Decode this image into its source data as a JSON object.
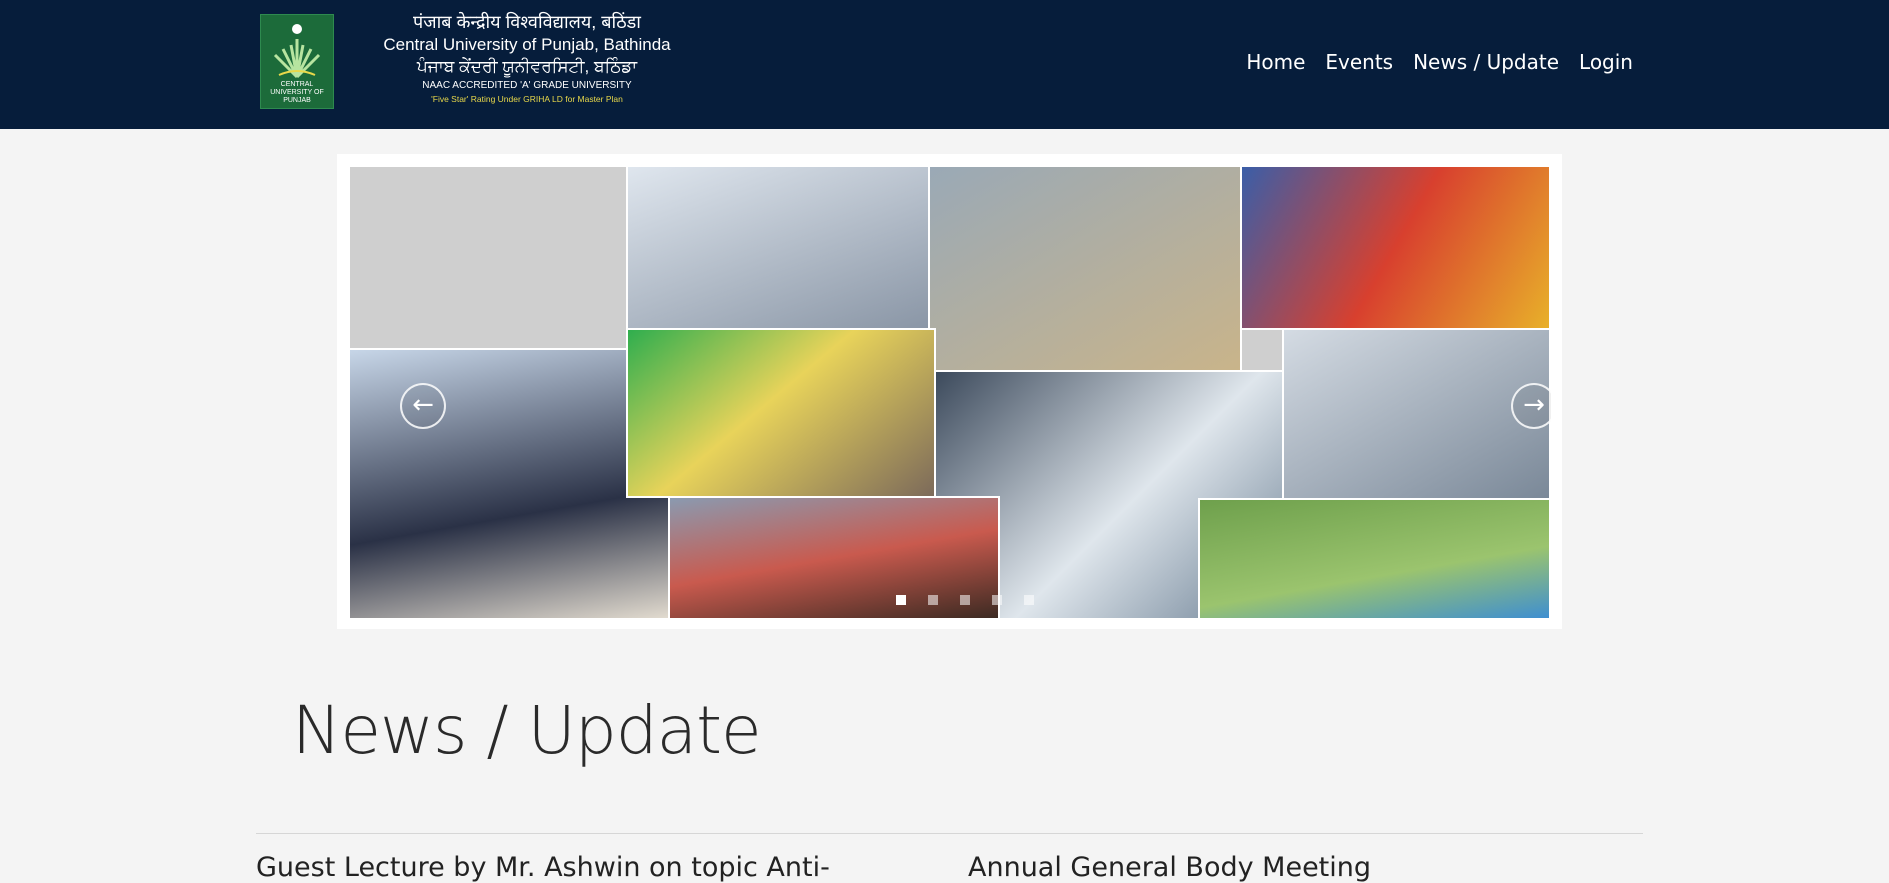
{
  "header": {
    "logo_caption": "CENTRAL UNIVERSITY OF PUNJAB",
    "name_hindi": "पंजाब केन्द्रीय विश्वविद्यालय, बठिंडा",
    "name_english": "Central University of Punjab, Bathinda",
    "name_punjabi": "ਪੰਜਾਬ ਕੇਂਦਰੀ ਯੂਨੀਵਰਸਿਟੀ, ਬਠਿੰਡਾ",
    "accreditation": "NAAC ACCREDITED 'A' GRADE UNIVERSITY",
    "rating": "'Five Star' Rating Under GRIHA LD for Master Plan",
    "nav": [
      "Home",
      "Events",
      "News / Update",
      "Login"
    ]
  },
  "carousel": {
    "prev_icon": "arrow-left-icon",
    "next_icon": "arrow-right-icon",
    "prev_glyph": "←",
    "next_glyph": "→",
    "slide_count": 5,
    "active_slide": 1
  },
  "main": {
    "section_title": "News / Update",
    "news": [
      "Guest Lecture by Mr. Ashwin on topic Anti-",
      "Annual General Body Meeting"
    ]
  },
  "colors": {
    "navbar": "#061d3b",
    "page_background": "#f4f4f4",
    "accent_rating": "#e8d84a"
  }
}
